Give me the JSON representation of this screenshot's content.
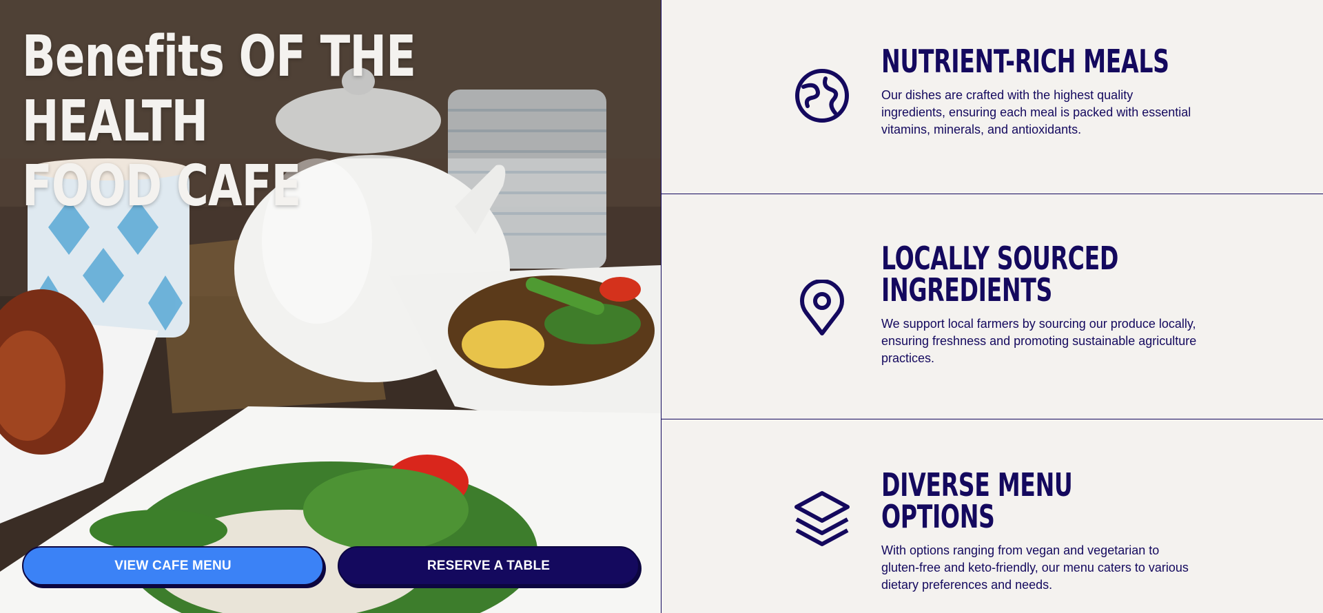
{
  "hero": {
    "title": "Benefits of the Health Food Cafe",
    "title_line1": "Benefits OF THE HEALTH",
    "title_line2": "FOOD CAFE",
    "photo_icon": "food-photo",
    "buttons": {
      "menu_label": "VIEW CAFE MENU",
      "reserve_label": "RESERVE A TABLE"
    }
  },
  "features": [
    {
      "icon": "globe-icon",
      "title": "Nutrient-rich meals",
      "description": "Our dishes are crafted with the highest quality ingredients, ensuring each meal is packed with essential vitamins, minerals, and antioxidants."
    },
    {
      "icon": "map-pin-icon",
      "title": "Locally sourced ingredients",
      "description": "We support local farmers by sourcing our produce locally, ensuring freshness and promoting sustainable agriculture practices."
    },
    {
      "icon": "layers-icon",
      "title": "Diverse menu options",
      "description": "With options ranging from vegan and vegetarian to gluten-free and keto-friendly, our menu caters to various dietary preferences and needs."
    }
  ],
  "colors": {
    "navy": "#14095e",
    "blue": "#3b82f6",
    "cream": "#f4f2ef"
  }
}
